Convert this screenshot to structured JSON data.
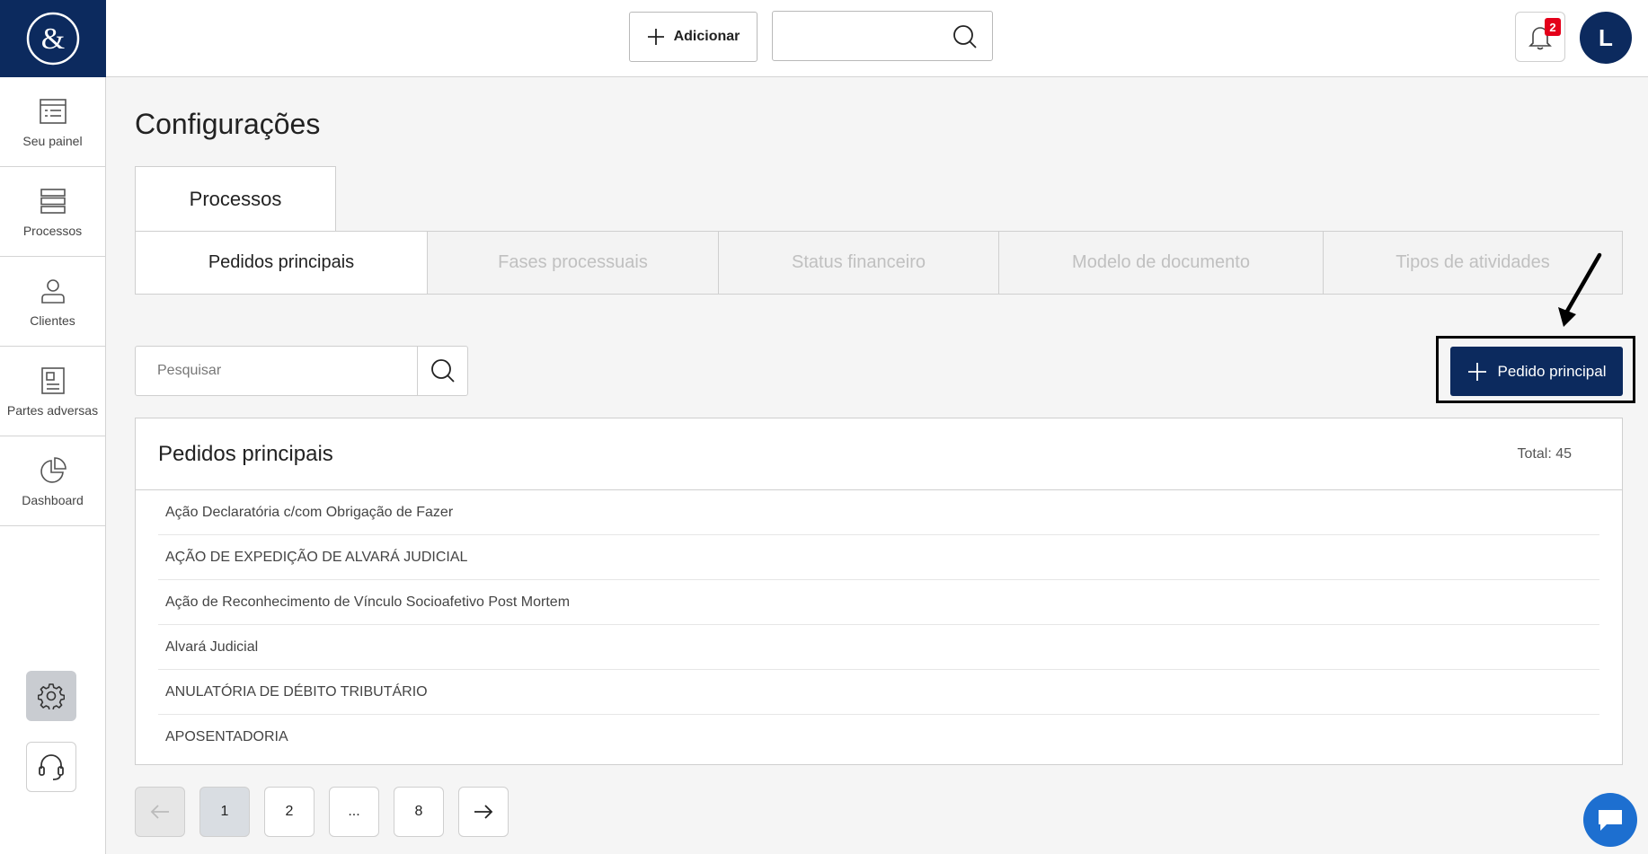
{
  "sidebar": {
    "items": [
      {
        "label": "Seu painel",
        "icon": "panel-icon"
      },
      {
        "label": "Processos",
        "icon": "list-icon"
      },
      {
        "label": "Clientes",
        "icon": "user-icon"
      },
      {
        "label": "Partes adversas",
        "icon": "document-icon"
      },
      {
        "label": "Dashboard",
        "icon": "pie-chart-icon"
      }
    ]
  },
  "topbar": {
    "add_label": "Adicionar",
    "search_placeholder": "",
    "notifications_count": "2",
    "avatar_initial": "L"
  },
  "page": {
    "title": "Configurações",
    "section_tab": "Processos",
    "subtabs": [
      "Pedidos principais",
      "Fases processuais",
      "Status financeiro",
      "Modelo de documento",
      "Tipos de atividades"
    ],
    "search_placeholder": "Pesquisar",
    "primary_button": "Pedido principal"
  },
  "list": {
    "title": "Pedidos principais",
    "total": "Total: 45",
    "rows": [
      "Ação Declaratória c/com Obrigação de Fazer",
      "AÇÃO DE EXPEDIÇÃO DE ALVARÁ JUDICIAL",
      "Ação de Reconhecimento de Vínculo Socioafetivo Post Mortem",
      "Alvará Judicial",
      "ANULATÓRIA DE DÉBITO TRIBUTÁRIO",
      "APOSENTADORIA"
    ]
  },
  "pagination": {
    "pages": [
      "1",
      "2",
      "...",
      "8"
    ]
  },
  "colors": {
    "brand": "#0c2a5e",
    "badge": "#e4001a",
    "chat": "#1d6fd0"
  }
}
